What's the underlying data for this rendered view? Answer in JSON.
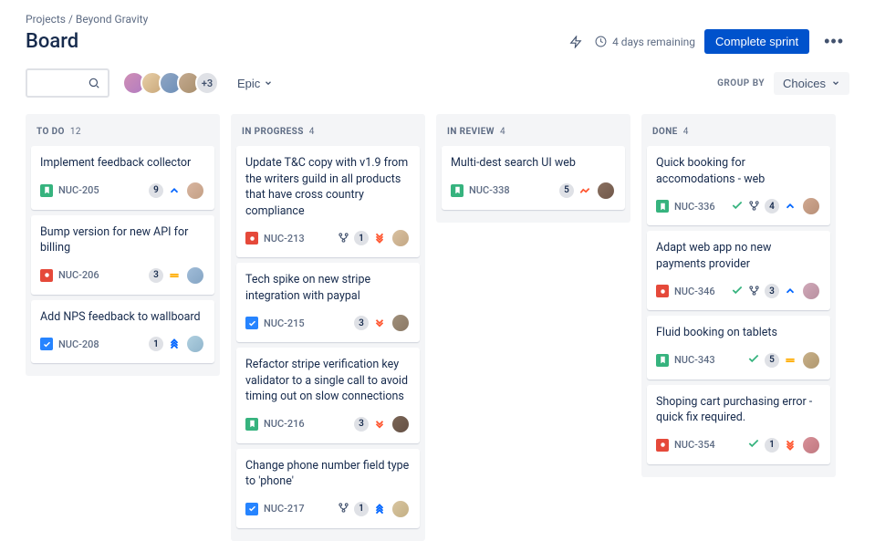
{
  "breadcrumb": {
    "projects": "Projects",
    "project": "Beyond Gravity"
  },
  "page_title": "Board",
  "header": {
    "remaining": "4 days remaining",
    "complete_sprint": "Complete sprint"
  },
  "filters": {
    "epic": "Epic",
    "group_by": "GROUP BY",
    "choices": "Choices",
    "extra_avatars": "+3"
  },
  "avatars": [
    {
      "bg": "linear-gradient(135deg,#d08fb5,#b27cc1)"
    },
    {
      "bg": "linear-gradient(135deg,#e8cfa8,#c9a87a)"
    },
    {
      "bg": "linear-gradient(135deg,#8fa6c4,#6d8fb8)"
    },
    {
      "bg": "linear-gradient(135deg,#c4aa8f,#a88f6d)"
    }
  ],
  "columns": [
    {
      "name": "TO DO",
      "count": "12",
      "cards": [
        {
          "title": "Implement feedback collector",
          "type": "story",
          "key": "NUC-205",
          "points": "9",
          "priority": "low",
          "assignee": {
            "bg": "linear-gradient(135deg,#d8b5a0,#c4a085)"
          }
        },
        {
          "title": "Bump version for new API for billing",
          "type": "bug",
          "key": "NUC-206",
          "points": "3",
          "priority": "med",
          "assignee": {
            "bg": "linear-gradient(135deg,#a0bcd8,#85a5c4)"
          }
        },
        {
          "title": "Add NPS feedback to wallboard",
          "type": "task",
          "key": "NUC-208",
          "points": "1",
          "priority": "lowest",
          "assignee": {
            "bg": "linear-gradient(135deg,#b0d0e0,#90b5cc)"
          }
        }
      ]
    },
    {
      "name": "IN PROGRESS",
      "count": "4",
      "cards": [
        {
          "title": "Update T&C copy with v1.9 from the writers guild in all products that have cross country compliance",
          "type": "bug",
          "key": "NUC-213",
          "branch": true,
          "points": "1",
          "priority": "highest",
          "assignee": {
            "bg": "linear-gradient(135deg,#d8c0a0,#c4a885)"
          }
        },
        {
          "title": "Tech spike on new stripe integration with paypal",
          "type": "task",
          "key": "NUC-215",
          "points": "3",
          "priority": "high",
          "assignee": {
            "bg": "linear-gradient(135deg,#a08f7a,#8a7865)"
          }
        },
        {
          "title": "Refactor stripe verification key validator to a single call to avoid timing out on slow connections",
          "type": "story",
          "key": "NUC-216",
          "points": "3",
          "priority": "high",
          "assignee": {
            "bg": "linear-gradient(135deg,#7a6555,#655045)"
          }
        },
        {
          "title": "Change phone number field type to 'phone'",
          "type": "task",
          "key": "NUC-217",
          "branch": true,
          "points": "1",
          "priority": "lowest",
          "assignee": {
            "bg": "linear-gradient(135deg,#d8c5a0,#c4b085)"
          }
        }
      ]
    },
    {
      "name": "IN REVIEW",
      "count": "4",
      "cards": [
        {
          "title": "Multi-dest search UI web",
          "type": "story",
          "key": "NUC-338",
          "points": "5",
          "priority": "high-single",
          "assignee": {
            "bg": "linear-gradient(135deg,#8a7060,#70584a)"
          }
        }
      ]
    },
    {
      "name": "DONE",
      "count": "4",
      "cards": [
        {
          "title": "Quick booking for accomodations - web",
          "type": "story",
          "key": "NUC-336",
          "done": true,
          "branch": true,
          "points": "4",
          "priority": "low",
          "assignee": {
            "bg": "linear-gradient(135deg,#d0a890,#b89078)"
          }
        },
        {
          "title": "Adapt web app no new payments provider",
          "type": "bug",
          "key": "NUC-346",
          "done": true,
          "branch": true,
          "points": "3",
          "priority": "low",
          "assignee": {
            "bg": "linear-gradient(135deg,#d0a8b8,#b890a0)"
          }
        },
        {
          "title": "Fluid booking on tablets",
          "type": "story",
          "key": "NUC-343",
          "done": true,
          "points": "5",
          "priority": "med",
          "assignee": {
            "bg": "linear-gradient(135deg,#c8b088,#b09870)"
          }
        },
        {
          "title": "Shoping cart purchasing error - quick fix required.",
          "type": "bug",
          "key": "NUC-354",
          "done": true,
          "points": "1",
          "priority": "highest",
          "assignee": {
            "bg": "linear-gradient(135deg,#d89098,#c07880)"
          }
        }
      ]
    }
  ]
}
